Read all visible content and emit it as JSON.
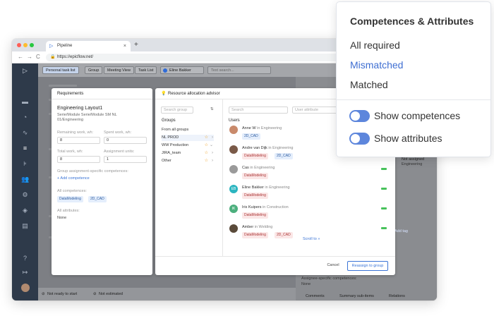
{
  "browser": {
    "tab_title": "Pipeline",
    "tab_close": "×",
    "new_tab": "+",
    "url": "https://epicflow.net/",
    "back": "←",
    "forward": "→",
    "reload": "C"
  },
  "toolbar": {
    "personal_task_list": "Personal task list",
    "group": "Group",
    "meeting_view": "Meeting View",
    "task_list": "Task List",
    "user": "Eline Bakker",
    "search_placeholder": "Text search..."
  },
  "right_pane": {
    "not_assigned": "Not assigned",
    "engineering": "Engineering",
    "add_tag": "Add tag",
    "assignee_specific_competences": "Assignee-specific competences:",
    "none": "None",
    "tabs": [
      "Comments",
      "Summary sub-items",
      "Relations"
    ]
  },
  "bottom_bar": {
    "not_ready": "Not ready to start",
    "not_estimated": "Not estimated"
  },
  "requirements": {
    "header": "Requirements",
    "title": "Engineering Layout1",
    "subtitle": "Serie/Module Serie/Module SM NL 01/Engineering",
    "remaining_label": "Remaining work, wh:",
    "spent_label": "Spent work, wh:",
    "remaining_value": "8",
    "spent_value": "0",
    "total_label": "Total work, wh:",
    "units_label": "Assignment units:",
    "total_value": "8",
    "units_value": "1",
    "group_specific": "Group assignment-specific competences:",
    "add_competence": "+ Add competence",
    "all_competences": "All competences:",
    "competences": [
      "DataModeling",
      "2D_CAD"
    ],
    "all_attributes": "All attributes:",
    "attributes_value": "None"
  },
  "advisor": {
    "header": "Resource allocation advisor",
    "search_group_placeholder": "Search group",
    "search_placeholder": "Search",
    "user_attribute_placeholder": "User attribute",
    "groups_heading": "Groups",
    "groups": [
      "From all groups",
      "NL PROD",
      "WW Production",
      "JIRA_team",
      "Other"
    ],
    "users_heading": "Users",
    "users": [
      {
        "name": "Anne W",
        "dept": "in Engineering",
        "initials": "AW",
        "color": "#c98a6b",
        "tags": [
          "2D_CAD"
        ]
      },
      {
        "name": "Andre van Dijk",
        "dept": "in Engineering",
        "initials": "AD",
        "color": "#7a5a48",
        "tags": [
          "DataModeling",
          "2D_CAD"
        ]
      },
      {
        "name": "Cas",
        "dept": "in Engineering",
        "initials": "C",
        "color": "#9a9a9a",
        "tags": [
          "DataModeling"
        ]
      },
      {
        "name": "Eline Bakker",
        "dept": "in Engineering",
        "initials": "EB",
        "color": "#2bb5c0",
        "tags": [
          "DataModeling"
        ]
      },
      {
        "name": "Iris Kuipers",
        "dept": "in Construction",
        "initials": "IK",
        "color": "#4caf7d",
        "tags": [
          "DataModeling"
        ]
      },
      {
        "name": "Amber",
        "dept": "in Welding",
        "initials": "A",
        "color": "#5a4a3a",
        "tags": [
          "DataModeling",
          "2D_CAD"
        ]
      }
    ],
    "scroll_to": "Scroll to »",
    "cancel": "Cancel",
    "reassign": "Reassign to group"
  },
  "popover": {
    "title": "Competences & Attributes",
    "options": [
      "All required",
      "Mismatched",
      "Matched"
    ],
    "selected_index": 1,
    "accent_color": "#3f6fd2",
    "toggles": [
      {
        "label": "Show competences",
        "on": true
      },
      {
        "label": "Show attributes",
        "on": true
      }
    ]
  }
}
